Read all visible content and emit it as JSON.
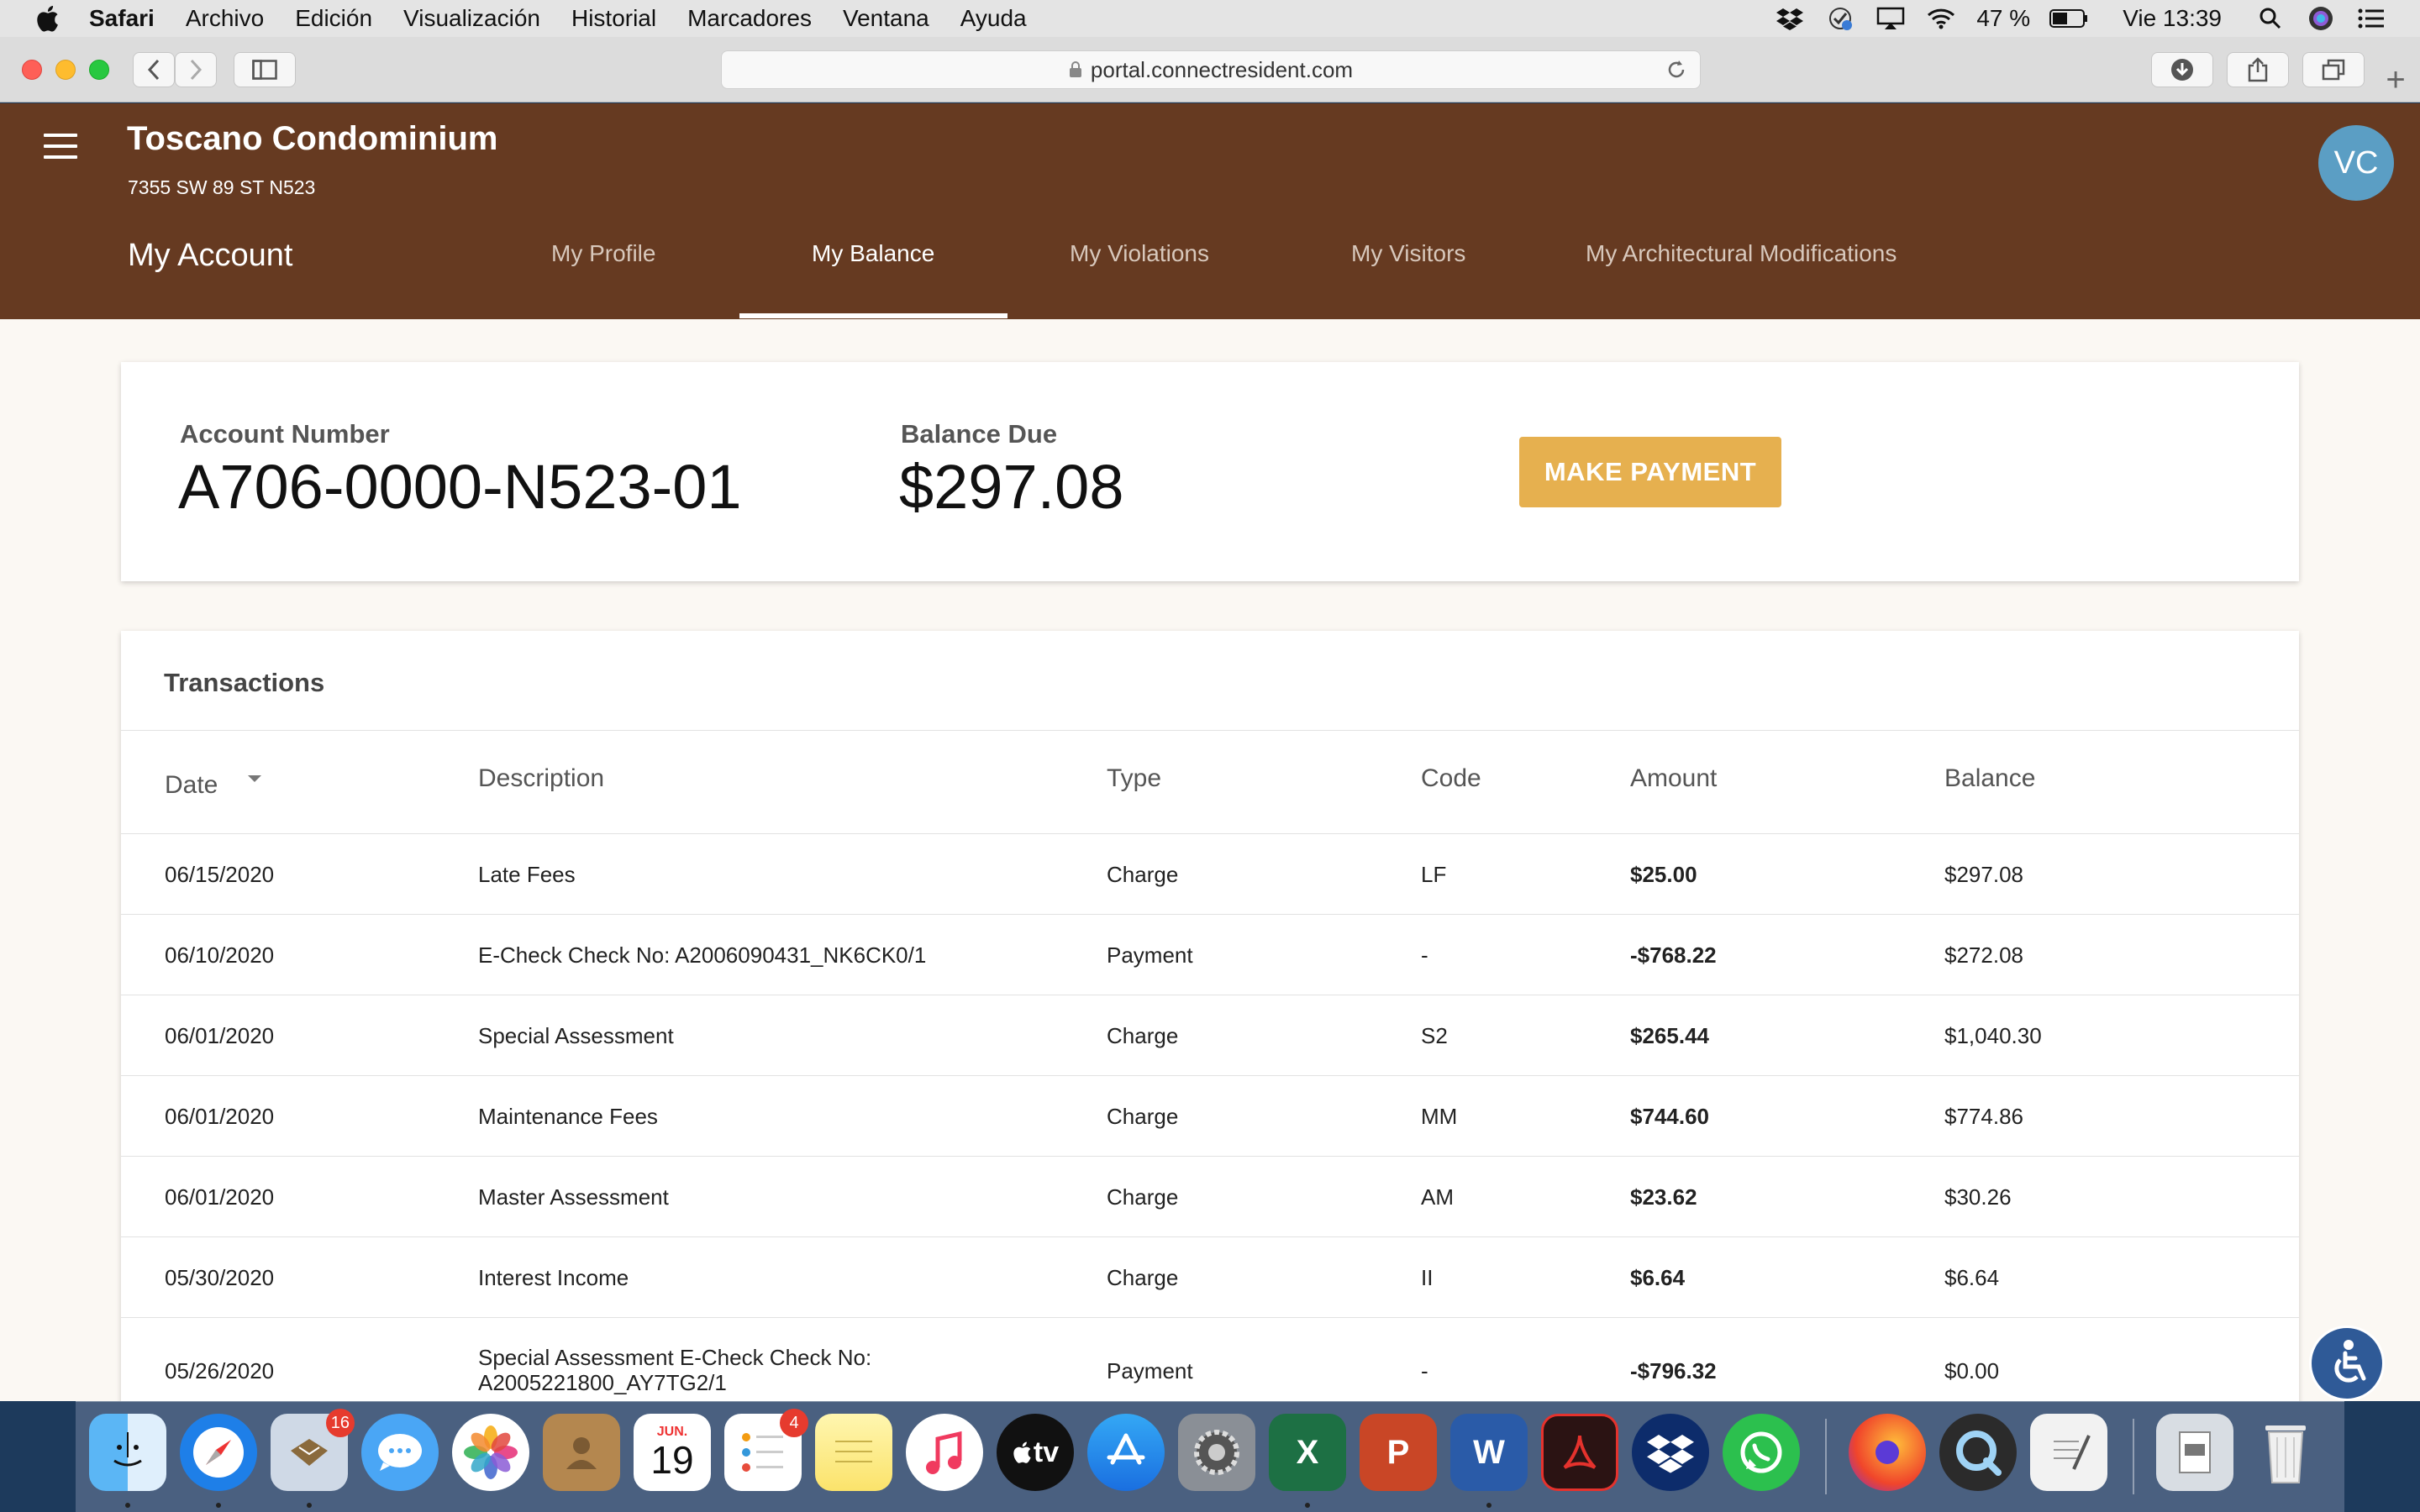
{
  "menubar": {
    "app_name": "Safari",
    "items": [
      "Archivo",
      "Edición",
      "Visualización",
      "Historial",
      "Marcadores",
      "Ventana",
      "Ayuda"
    ],
    "battery": "47 %",
    "clock": "Vie 13:39"
  },
  "browser": {
    "url": "portal.connectresident.com"
  },
  "header": {
    "org_name": "Toscano Condominium",
    "address": "7355 SW 89 ST N523",
    "section_title": "My Account",
    "avatar_initials": "VC",
    "tabs": [
      {
        "label": "My Profile",
        "active": false
      },
      {
        "label": "My Balance",
        "active": true
      },
      {
        "label": "My Violations",
        "active": false
      },
      {
        "label": "My Visitors",
        "active": false
      },
      {
        "label": "My Architectural Modifications",
        "active": false
      }
    ]
  },
  "summary": {
    "account_label": "Account Number",
    "account_number": "A706-0000-N523-01",
    "balance_label": "Balance Due",
    "balance_due": "$297.08",
    "pay_button": "MAKE PAYMENT"
  },
  "transactions": {
    "title": "Transactions",
    "columns": [
      "Date",
      "Description",
      "Type",
      "Code",
      "Amount",
      "Balance"
    ],
    "rows": [
      {
        "date": "06/15/2020",
        "description": "Late Fees",
        "type": "Charge",
        "code": "LF",
        "amount": "$25.00",
        "balance": "$297.08"
      },
      {
        "date": "06/10/2020",
        "description": "E-Check Check No: A2006090431_NK6CK0/1",
        "type": "Payment",
        "code": "-",
        "amount": "-$768.22",
        "balance": "$272.08"
      },
      {
        "date": "06/01/2020",
        "description": "Special Assessment",
        "type": "Charge",
        "code": "S2",
        "amount": "$265.44",
        "balance": "$1,040.30"
      },
      {
        "date": "06/01/2020",
        "description": "Maintenance Fees",
        "type": "Charge",
        "code": "MM",
        "amount": "$744.60",
        "balance": "$774.86"
      },
      {
        "date": "06/01/2020",
        "description": "Master Assessment",
        "type": "Charge",
        "code": "AM",
        "amount": "$23.62",
        "balance": "$30.26"
      },
      {
        "date": "05/30/2020",
        "description": "Interest Income",
        "type": "Charge",
        "code": "II",
        "amount": "$6.64",
        "balance": "$6.64"
      },
      {
        "date": "05/26/2020",
        "description": "Special Assessment E-Check Check No: A2005221800_AY7TG2/1",
        "type": "Payment",
        "code": "-",
        "amount": "-$796.32",
        "balance": "$0.00"
      }
    ]
  },
  "dock": {
    "mail_badge": "16",
    "calendar_month": "JUN.",
    "calendar_day": "19",
    "reminders_badge": "4",
    "tv_label": "tv"
  },
  "colors": {
    "header_bg": "#663a21",
    "page_bg": "#fbf8f3",
    "pay_button": "#e6b04f",
    "avatar": "#5b9ec4"
  }
}
